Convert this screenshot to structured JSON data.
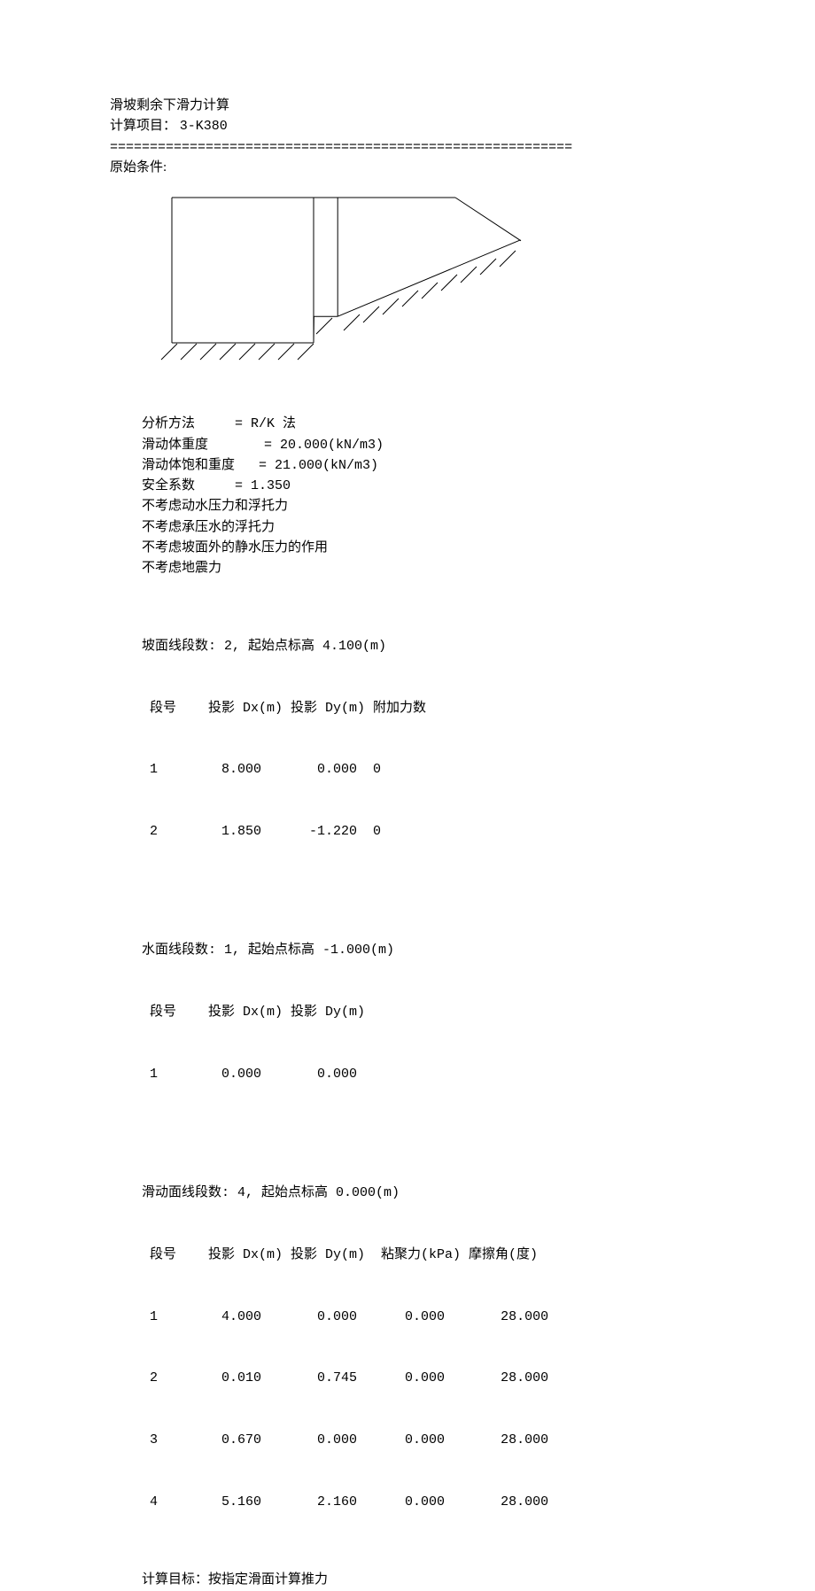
{
  "title": "滑坡剩余下滑力计算",
  "project_label": "计算项目：",
  "project_name": "3-K380",
  "divider": "==========================================================",
  "conditions_heading": "原始条件:",
  "params": {
    "analysis_method_label": "分析方法",
    "analysis_method_value": "= R/K 法",
    "unit_weight_label": "滑动体重度",
    "unit_weight_value": "= 20.000(kN/m3)",
    "sat_unit_weight_label": "滑动体饱和重度",
    "sat_unit_weight_value": "= 21.000(kN/m3)",
    "safety_factor_label": "安全系数",
    "safety_factor_value": "= 1.350",
    "note1": "不考虑动水压力和浮托力",
    "note2": "不考虑承压水的浮托力",
    "note3": "不考虑坡面外的静水压力的作用",
    "note4": "不考虑地震力"
  },
  "slope_surface": {
    "header": "坡面线段数: 2, 起始点标高 4.100(m)",
    "col_header": " 段号    投影 Dx(m) 投影 Dy(m) 附加力数",
    "rows": [
      " 1        8.000       0.000  0",
      " 2        1.850      -1.220  0"
    ]
  },
  "water_surface": {
    "header": "水面线段数: 1, 起始点标高 -1.000(m)",
    "col_header": " 段号    投影 Dx(m) 投影 Dy(m)",
    "rows": [
      " 1        0.000       0.000"
    ]
  },
  "slip_surface": {
    "header": "滑动面线段数: 4, 起始点标高 0.000(m)",
    "col_header": " 段号    投影 Dx(m) 投影 Dy(m)  粘聚力(kPa) 摩擦角(度)",
    "rows": [
      " 1        4.000       0.000      0.000       28.000",
      " 2        0.010       0.745      0.000       28.000",
      " 3        0.670       0.000      0.000       28.000",
      " 4        5.160       2.160      0.000       28.000"
    ]
  },
  "calc_target_line": " 计算目标：按指定滑面计算推力",
  "chart_data": {
    "type": "line",
    "title": "",
    "xlabel": "",
    "ylabel": "",
    "series": [
      {
        "name": "slope_surface",
        "points": [
          [
            0.0,
            4.1
          ],
          [
            8.0,
            4.1
          ],
          [
            9.85,
            2.88
          ]
        ]
      },
      {
        "name": "slip_surface",
        "points": [
          [
            0.0,
            0.0
          ],
          [
            4.0,
            0.0
          ],
          [
            4.01,
            0.745
          ],
          [
            4.68,
            0.745
          ],
          [
            9.84,
            2.905
          ]
        ]
      },
      {
        "name": "left_vertical",
        "points": [
          [
            0.0,
            0.0
          ],
          [
            0.0,
            4.1
          ]
        ]
      },
      {
        "name": "inner_vertical_1",
        "points": [
          [
            4.0,
            0.0
          ],
          [
            4.0,
            4.1
          ]
        ]
      },
      {
        "name": "inner_vertical_2",
        "points": [
          [
            4.68,
            0.745
          ],
          [
            4.68,
            4.1
          ]
        ]
      }
    ],
    "xlim": [
      0,
      10
    ],
    "ylim": [
      0,
      4.5
    ]
  }
}
